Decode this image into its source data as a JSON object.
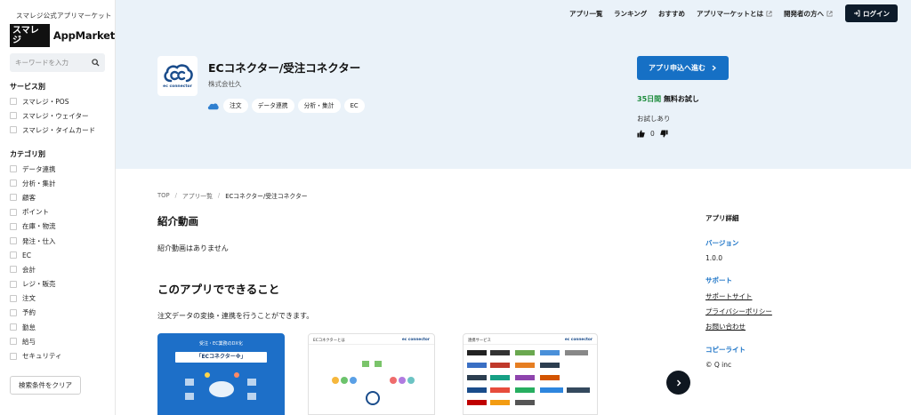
{
  "sidebar": {
    "brand_sub": "スマレジ公式アプリマーケット",
    "brand_box": "スマレジ",
    "brand_text": "AppMarket",
    "search_placeholder": "キーワードを入力",
    "service_title": "サービス別",
    "services": [
      "スマレジ・POS",
      "スマレジ・ウェイター",
      "スマレジ・タイムカード"
    ],
    "category_title": "カテゴリ別",
    "categories": [
      "データ連携",
      "分析・集計",
      "顧客",
      "ポイント",
      "在庫・物流",
      "発注・仕入",
      "EC",
      "会計",
      "レジ・販売",
      "注文",
      "予約",
      "勤怠",
      "給与",
      "セキュリティ"
    ],
    "clear_label": "検索条件をクリア"
  },
  "nav": {
    "items": [
      "アプリ一覧",
      "ランキング",
      "おすすめ",
      "アプリマーケットとは",
      "開発者の方へ"
    ],
    "login": "ログイン"
  },
  "app": {
    "icon_label": "ec connector",
    "title": "ECコネクター/受注コネクター",
    "company": "株式会社久",
    "tags": [
      "注文",
      "データ連携",
      "分析・集計",
      "EC"
    ],
    "apply_label": "アプリ申込へ進む",
    "trial_days": "35日間",
    "trial_text": "無料お試し",
    "trial_note": "お試しあり",
    "votes": "0"
  },
  "breadcrumb": [
    "TOP",
    "アプリ一覧",
    "ECコネクター/受注コネクター"
  ],
  "main": {
    "video_heading": "紹介動画",
    "no_video": "紹介動画はありません",
    "can_heading": "このアプリでできること",
    "description": "注文データの変換・連携を行うことができます。",
    "shot1_head": "受注・EC業務のDX化",
    "shot1_banner": "「ECコネクター※」",
    "shot2_title": "ECコネクターとは",
    "shot2_brand": "ec connector",
    "shot3_title": "連携サービス",
    "shot3_brand": "ec connector"
  },
  "details": {
    "title": "アプリ詳細",
    "version_label": "バージョン",
    "version": "1.0.0",
    "support_label": "サポート",
    "support_links": [
      "サポートサイト",
      "プライバシーポリシー",
      "お問い合わせ"
    ],
    "copyright_label": "コピーライト",
    "copyright": "© Q inc"
  },
  "colors": {
    "accent": "#1670c5",
    "hero_bg": "#eaf2f9",
    "login_bg": "#0d1b2a",
    "trial_green": "#1a8a3a"
  }
}
